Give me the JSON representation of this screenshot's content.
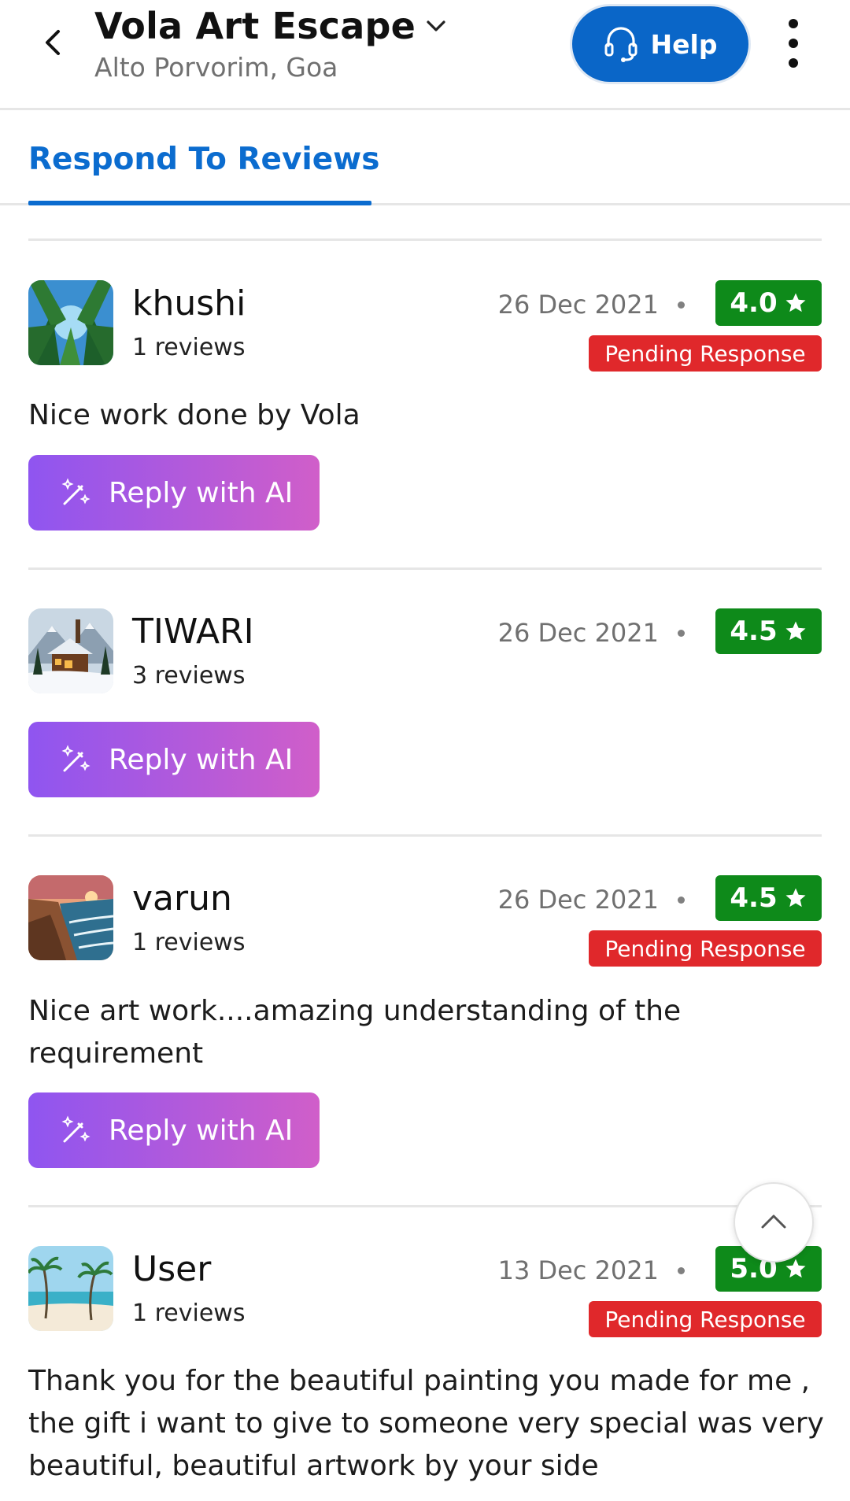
{
  "header": {
    "title": "Vola Art Escape",
    "subtitle": "Alto Porvorim, Goa",
    "help_label": "Help",
    "icons": [
      "back-arrow-icon",
      "chevron-down-icon",
      "headset-icon",
      "more-vertical-icon"
    ]
  },
  "tabs": [
    {
      "label": "Respond To Reviews",
      "active": true
    }
  ],
  "colors": {
    "primary_blue": "#0b6ccf",
    "rating_green": "#0e8a1a",
    "pending_red": "#e0282b",
    "ai_gradient_start": "#8f55f0",
    "ai_gradient_end": "#d05ec9"
  },
  "reviews": [
    {
      "name": "khushi",
      "review_count": "1 reviews",
      "date": "26 Dec 2021",
      "rating": "4.0",
      "status": "Pending Response",
      "text": "Nice work done by Vola",
      "reply_label": "Reply with AI",
      "avatar": "forest-canopy-image"
    },
    {
      "name": "TIWARI",
      "review_count": "3 reviews",
      "date": "26 Dec 2021",
      "rating": "4.5",
      "status": "",
      "text": "",
      "reply_label": "Reply with AI",
      "avatar": "snowy-cabin-image"
    },
    {
      "name": "varun",
      "review_count": "1 reviews",
      "date": "26 Dec 2021",
      "rating": "4.5",
      "status": "Pending Response",
      "text": "Nice art work....amazing understanding of the requirement",
      "reply_label": "Reply with AI",
      "avatar": "coastal-cliffs-image"
    },
    {
      "name": "User",
      "review_count": "1 reviews",
      "date": "13 Dec 2021",
      "rating": "5.0",
      "status": "Pending Response",
      "text": "Thank you for the beautiful painting you made for me , the gift i want to give to someone very special was very beautiful, beautiful artwork by your side",
      "reply_label": "",
      "avatar": "palm-beach-image"
    }
  ]
}
